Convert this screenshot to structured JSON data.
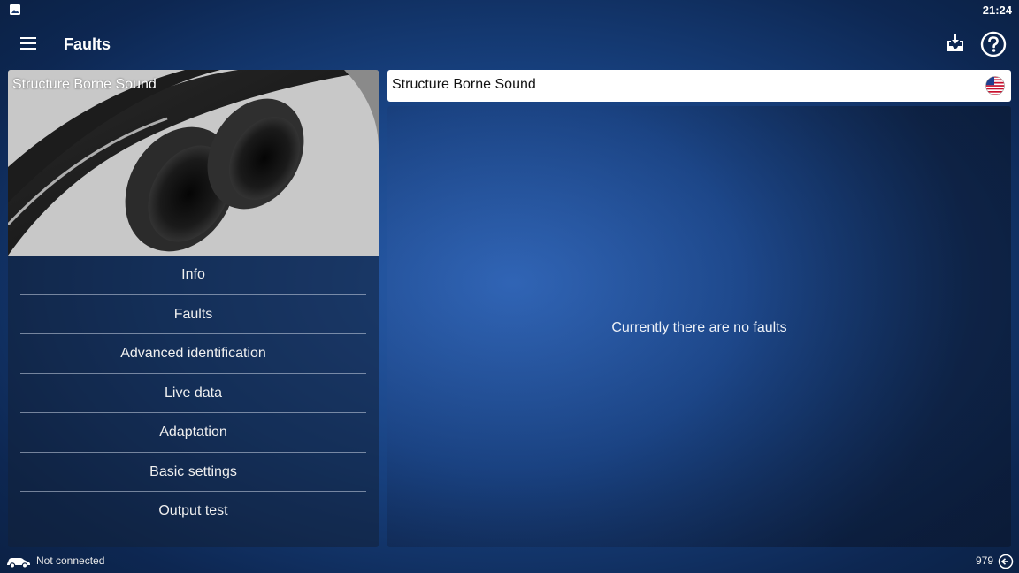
{
  "status_bar": {
    "time": "21:24",
    "left_icon": "image-icon"
  },
  "app_bar": {
    "title": "Faults",
    "left_icon": "hamburger-menu-icon",
    "right_icons": [
      "download-inbox-icon",
      "help-icon"
    ]
  },
  "left_panel": {
    "hero_title": "Structure Borne Sound",
    "hero_image": "exhaust-pipes-image",
    "menu_items": [
      {
        "label": "Info"
      },
      {
        "label": "Faults"
      },
      {
        "label": "Advanced identification"
      },
      {
        "label": "Live data"
      },
      {
        "label": "Adaptation"
      },
      {
        "label": "Basic settings"
      },
      {
        "label": "Output test"
      }
    ]
  },
  "ecu_bar": {
    "name": "Structure Borne Sound",
    "flag_icon": "us-flag-icon"
  },
  "faults_panel": {
    "message": "Currently there are no faults"
  },
  "bottom_bar": {
    "connection_icon": "car-icon",
    "connection_status": "Not connected",
    "counter": "979",
    "exit_icon": "exit-icon"
  },
  "colors": {
    "background": "#17407e",
    "panel": "#122038",
    "ecu_bar_bg": "#ffffff"
  }
}
